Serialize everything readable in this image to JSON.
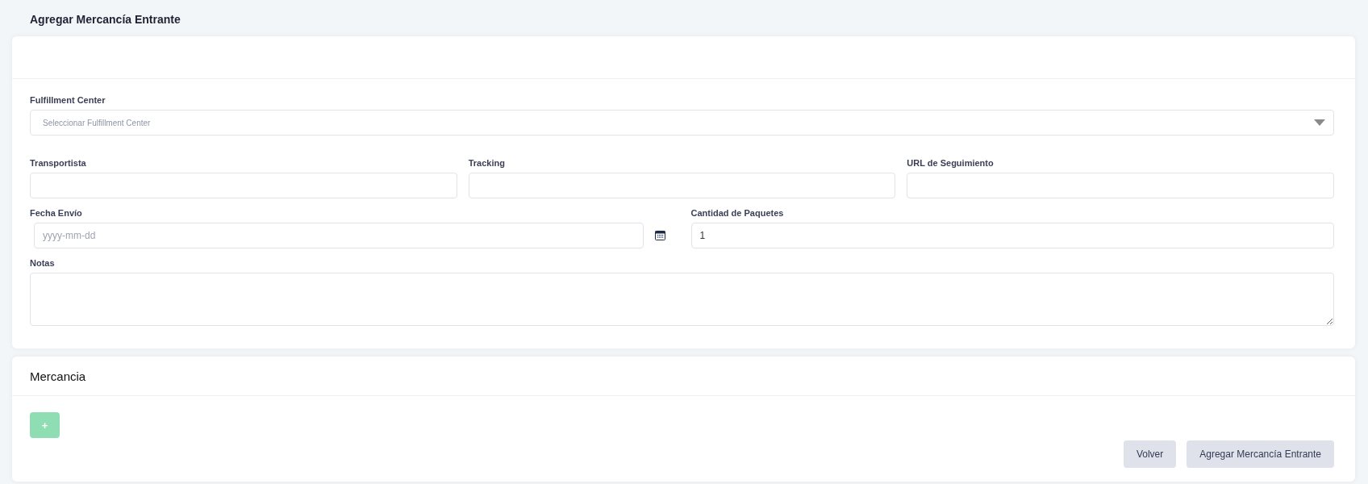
{
  "page_title": "Agregar Mercancía Entrante",
  "form": {
    "fulfillment_center": {
      "label": "Fulfillment Center",
      "placeholder": "Seleccionar Fulfillment Center"
    },
    "row_fields": [
      {
        "label": "Transportista"
      },
      {
        "label": "Tracking"
      },
      {
        "label": "URL de Seguimiento"
      }
    ],
    "fecha_envio": {
      "label": "Fecha Envío",
      "placeholder": "yyyy-mm-dd"
    },
    "cantidad_paquetes": {
      "label": "Cantidad de Paquetes",
      "value": "1"
    },
    "notas": {
      "label": "Notas"
    }
  },
  "mercancia": {
    "title": "Mercancia",
    "add_button": "+",
    "disabled": true
  },
  "buttons": [
    "Volver",
    "Agregar Mercancía Entrante"
  ]
}
